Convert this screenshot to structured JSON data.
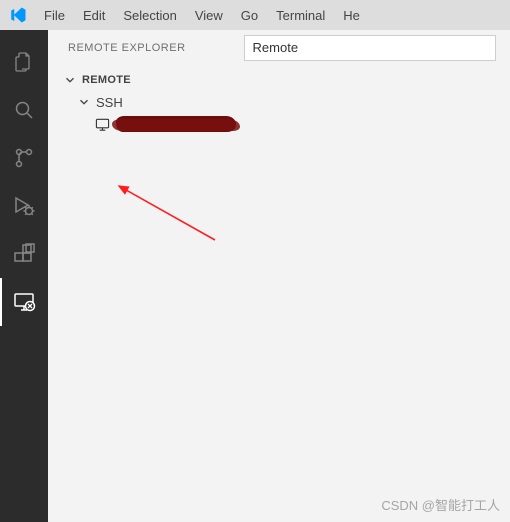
{
  "menubar": {
    "items": [
      "File",
      "Edit",
      "Selection",
      "View",
      "Go",
      "Terminal",
      "He"
    ]
  },
  "sidebar": {
    "title": "REMOTE EXPLORER",
    "dropdown": "Remote",
    "tree": {
      "section": "REMOTE",
      "ssh": "SSH",
      "host_redacted": ""
    }
  },
  "watermark": "CSDN @智能打工人",
  "colors": {
    "activitybar": "#2c2c2c",
    "sidebar": "#f3f3f3",
    "menubar": "#dddddd",
    "redaction": "#6a0d0d"
  }
}
